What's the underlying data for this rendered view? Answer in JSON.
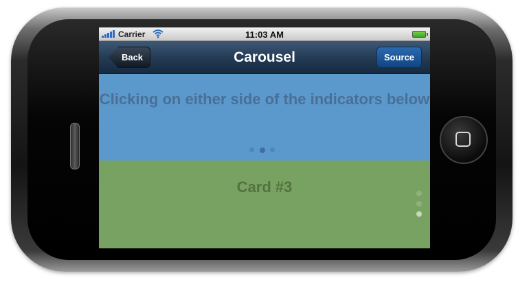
{
  "status_bar": {
    "carrier": "Carrier",
    "time": "11:03 AM"
  },
  "nav": {
    "title": "Carousel",
    "back_label": "Back",
    "source_label": "Source"
  },
  "carousel_top": {
    "text": "Clicking on either side of the indicators below",
    "page_count": 3,
    "active_page": 2
  },
  "carousel_bottom": {
    "card_label": "Card #3",
    "page_count": 3,
    "active_page": 3
  },
  "colors": {
    "top_bg": "#5b99cc",
    "bottom_bg": "#78a261",
    "nav_bg": "#243c56",
    "source_button": "#1e5596"
  },
  "icons": {
    "signal": "signal-bars-icon",
    "wifi": "wifi-icon",
    "battery": "battery-icon",
    "home": "home-button-icon"
  }
}
